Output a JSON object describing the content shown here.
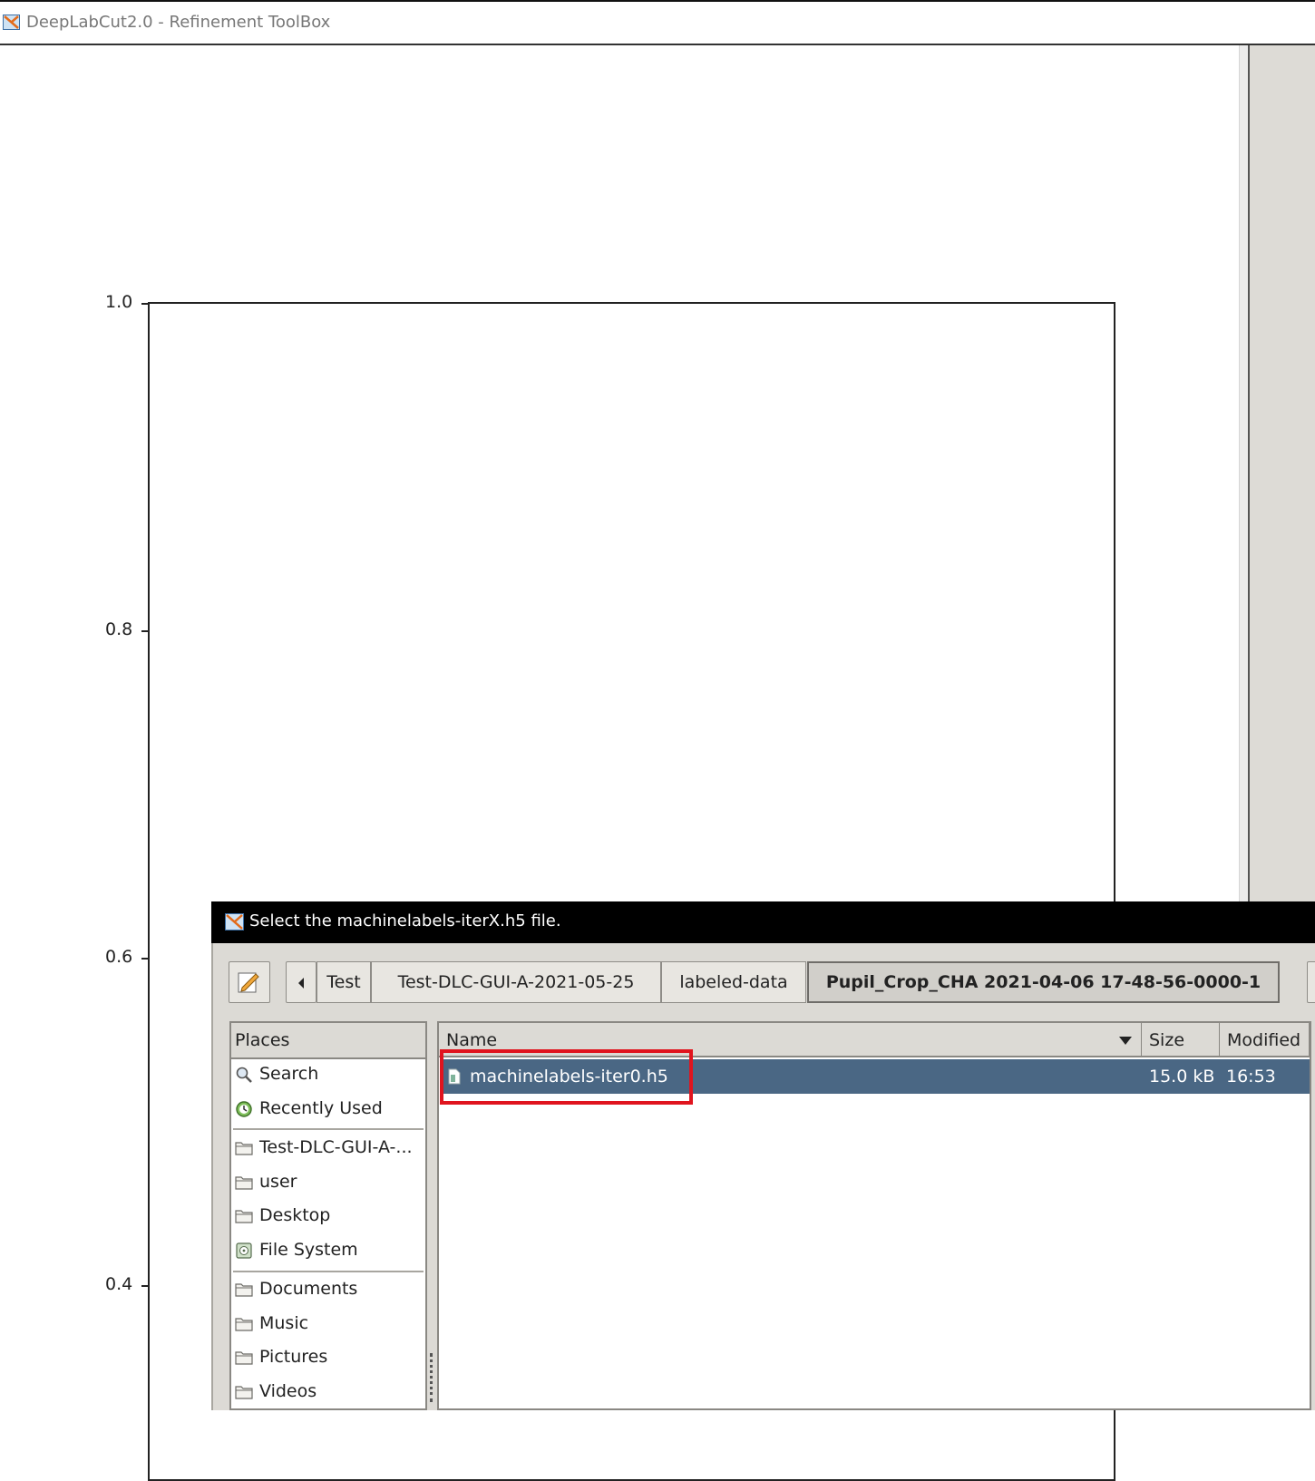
{
  "window": {
    "title": "DeepLabCut2.0 - Refinement ToolBox"
  },
  "plot": {
    "y_ticks": [
      "1.0",
      "0.8",
      "0.6",
      "0.4"
    ]
  },
  "dialog": {
    "title": "Select the machinelabels-iterX.h5 file.",
    "breadcrumbs": [
      "Test",
      "Test-DLC-GUI-A-2021-05-25",
      "labeled-data",
      "Pupil_Crop_CHA 2021-04-06 17-48-56-0000-1"
    ],
    "places_header": "Places",
    "places": [
      {
        "label": "Search",
        "icon": "search-icon"
      },
      {
        "label": "Recently Used",
        "icon": "recent-icon"
      },
      {
        "label": "Test-DLC-GUI-A-...",
        "icon": "folder-icon"
      },
      {
        "label": "user",
        "icon": "folder-icon"
      },
      {
        "label": "Desktop",
        "icon": "folder-icon"
      },
      {
        "label": "File System",
        "icon": "drive-icon"
      },
      {
        "label": "Documents",
        "icon": "folder-icon"
      },
      {
        "label": "Music",
        "icon": "folder-icon"
      },
      {
        "label": "Pictures",
        "icon": "folder-icon"
      },
      {
        "label": "Videos",
        "icon": "folder-icon"
      }
    ],
    "columns": {
      "name": "Name",
      "size": "Size",
      "modified": "Modified"
    },
    "files": [
      {
        "name": "machinelabels-iter0.h5",
        "size": "15.0 kB",
        "modified": "16:53",
        "selected": true
      }
    ],
    "highlight_color": "#e0141e",
    "selection_color": "#4a6784"
  }
}
